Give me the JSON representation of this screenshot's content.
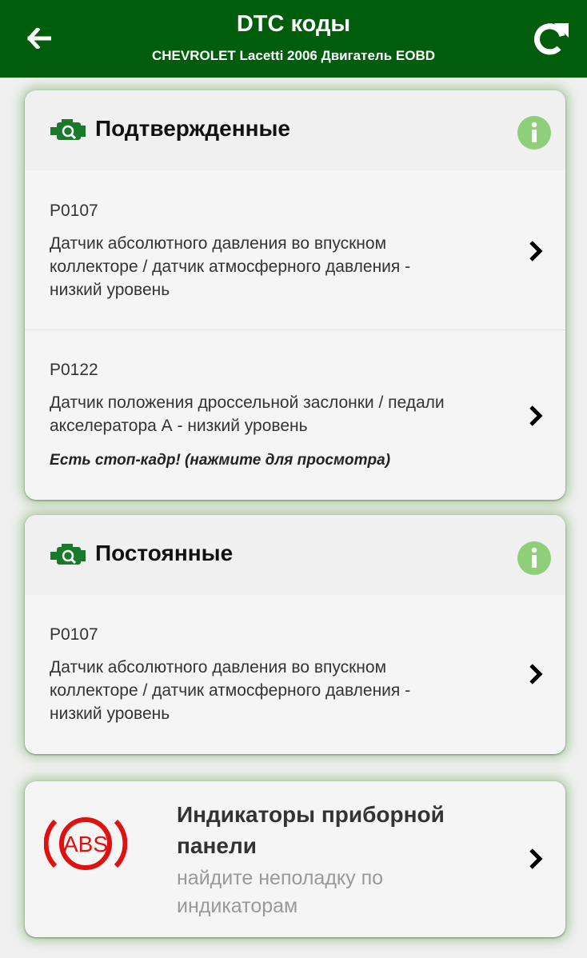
{
  "header": {
    "title": "DTC коды",
    "subtitle": "CHEVROLET Lacetti 2006 Двигатель EOBD",
    "back_icon": "arrow-left-icon",
    "refresh_icon": "refresh-icon",
    "bg_color": "#005d0c"
  },
  "sections": [
    {
      "title": "Подтвержденные",
      "icon": "engine-check-icon",
      "items": [
        {
          "code": "P0107",
          "lines": [
            "Датчик абсолютного давления во впускном",
            "коллекторе / датчик атмосферного давления -",
            "низкий уровень"
          ]
        },
        {
          "code": "P0122",
          "lines": [
            "Датчик положения дроссельной заслонки / педали",
            "акселератора А - низкий уровень"
          ],
          "freeze": "Есть стоп-кадр! (нажмите для просмотра)"
        }
      ]
    },
    {
      "title": "Постоянные",
      "icon": "engine-check-icon",
      "items": [
        {
          "code": "P0107",
          "lines": [
            "Датчик абсолютного давления во впускном",
            "коллекторе / датчик атмосферного давления -",
            "низкий уровень"
          ]
        }
      ]
    }
  ],
  "dashboard": {
    "title_lines": [
      "Индикаторы приборной",
      "панели"
    ],
    "subtitle_lines": [
      "найдите неполадку по",
      "индикаторам"
    ],
    "icon_label": "ABS",
    "icon": "abs-warning-icon"
  },
  "colors": {
    "engine_icon": "#1a7a2c",
    "info_icon": "#8fcf7a",
    "abs_red": "#e01010"
  }
}
